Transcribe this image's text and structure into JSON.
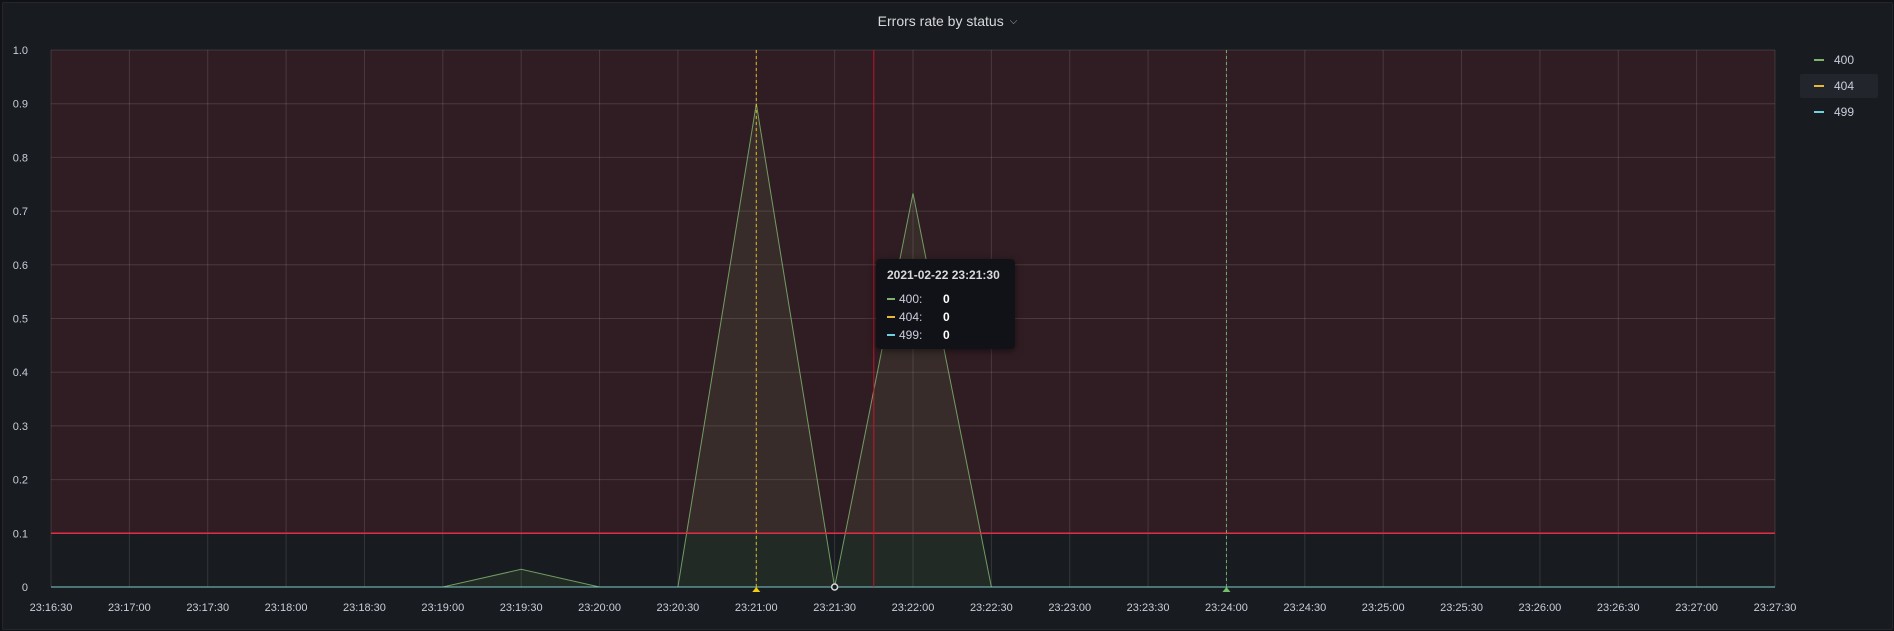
{
  "panel": {
    "title": "Errors rate by status"
  },
  "legend": {
    "items": [
      {
        "label": "400",
        "color": "#7eb26d"
      },
      {
        "label": "404",
        "color": "#eab839"
      },
      {
        "label": "499",
        "color": "#6ed0e0"
      }
    ]
  },
  "tooltip": {
    "time": "2021-02-22 23:21:30",
    "rows": [
      {
        "label": "400:",
        "value": "0",
        "color": "#7eb26d"
      },
      {
        "label": "404:",
        "value": "0",
        "color": "#eab839"
      },
      {
        "label": "499:",
        "value": "0",
        "color": "#6ed0e0"
      }
    ]
  },
  "chart_data": {
    "type": "area",
    "title": "Errors rate by status",
    "xlabel": "",
    "ylabel": "",
    "x_start": "23:16:30",
    "x_end": "23:27:30",
    "ylim": [
      0,
      1
    ],
    "y_ticks": [
      "0",
      "0.1",
      "0.2",
      "0.3",
      "0.4",
      "0.5",
      "0.6",
      "0.7",
      "0.8",
      "0.9",
      "1.0"
    ],
    "x_ticks": [
      "23:16:30",
      "23:17:00",
      "23:17:30",
      "23:18:00",
      "23:18:30",
      "23:19:00",
      "23:19:30",
      "23:20:00",
      "23:20:30",
      "23:21:00",
      "23:21:30",
      "23:22:00",
      "23:22:30",
      "23:23:00",
      "23:23:30",
      "23:24:00",
      "23:24:30",
      "23:25:00",
      "23:25:30",
      "23:26:00",
      "23:26:30",
      "23:27:00",
      "23:27:30"
    ],
    "grid": true,
    "legend_position": "right",
    "threshold": {
      "value": 0.1,
      "color": "#e02f44",
      "mode": "gt"
    },
    "series": [
      {
        "name": "400",
        "color": "#7eb26d",
        "points": [
          [
            "23:16:30",
            0
          ],
          [
            "23:19:00",
            0
          ],
          [
            "23:19:30",
            0.033
          ],
          [
            "23:20:00",
            0
          ],
          [
            "23:20:30",
            0
          ],
          [
            "23:21:00",
            0.9
          ],
          [
            "23:21:30",
            0
          ],
          [
            "23:22:00",
            0.733
          ],
          [
            "23:22:30",
            0
          ],
          [
            "23:27:30",
            0
          ]
        ]
      },
      {
        "name": "404",
        "color": "#eab839",
        "points": [
          [
            "23:16:30",
            0
          ],
          [
            "23:27:30",
            0
          ]
        ]
      },
      {
        "name": "499",
        "color": "#6ed0e0",
        "points": [
          [
            "23:16:30",
            0
          ],
          [
            "23:27:30",
            0
          ]
        ]
      }
    ],
    "annotations": [
      {
        "time": "23:21:00",
        "color": "#f2cc0c"
      },
      {
        "time": "23:24:00",
        "color": "#73bf69"
      }
    ],
    "crosshair_time": "23:21:30",
    "region_marker_time": "23:21:45"
  }
}
